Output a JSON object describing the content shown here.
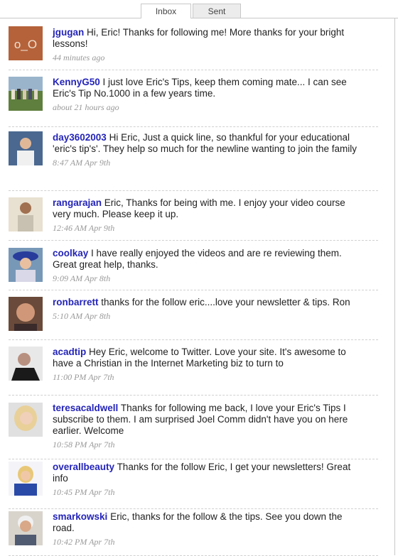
{
  "tabs": [
    {
      "label": "Inbox",
      "active": true
    },
    {
      "label": "Sent",
      "active": false
    }
  ],
  "messages": [
    {
      "user": "jgugan",
      "text": "Hi, Eric! Thanks for following me! More thanks for your bright lessons!",
      "time": "44 minutes ago",
      "avatar_label": "o_O",
      "avatar_color": "#b5623a"
    },
    {
      "user": "KennyG50",
      "text": "I just love Eric's Tips, keep them coming mate... I can see Eric's Tip No.1000 in a few years time.",
      "time": "about 21 hours ago",
      "avatar_color": "#6a8a4a"
    },
    {
      "user": "day3602003",
      "text": "Hi Eric, Just a quick line, so thankful for your educational 'eric's tip's'. They help so much for the newline wanting to join the family",
      "time": "8:47 AM Apr 9th",
      "avatar_color": "#3c5a8a"
    },
    {
      "user": "rangarajan",
      "text": "Eric, Thanks for being with me. I enjoy your video course very much. Please keep it up.",
      "time": "12:46 AM Apr 9th",
      "avatar_color": "#c8b8a0"
    },
    {
      "user": "coolkay",
      "text": "I have really enjoyed the videos and are re reviewing them. Great great help, thanks.",
      "time": "9:09 AM Apr 8th",
      "avatar_color": "#2c3c9c"
    },
    {
      "user": "ronbarrett",
      "text": "thanks for the follow eric....love your newsletter & tips. Ron",
      "time": "5:10 AM Apr 8th",
      "avatar_color": "#8a5a3a"
    },
    {
      "user": "acadtip",
      "text": "Hey Eric, welcome to Twitter. Love your site. It's awesome to have a Christian in the Internet Marketing biz to turn to",
      "time": "11:00 PM Apr 7th",
      "avatar_color": "#3a3a3a"
    },
    {
      "user": "teresacaldwell",
      "text": "Thanks for following me back, I love your Eric's Tips I subscribe to them. I am surprised Joel Comm didn't have you on here earlier. Welcome",
      "time": "10:58 PM Apr 7th",
      "avatar_color": "#d8c8a8"
    },
    {
      "user": "overallbeauty",
      "text": "Thanks for the follow Eric, I get your newsletters! Great info",
      "time": "10:45 PM Apr 7th",
      "avatar_color": "#2a4a9a"
    },
    {
      "user": "smarkowski",
      "text": "Eric, thanks for the follow & the tips. See you down the road.",
      "time": "10:42 PM Apr 7th",
      "avatar_color": "#c0b8b0"
    }
  ]
}
